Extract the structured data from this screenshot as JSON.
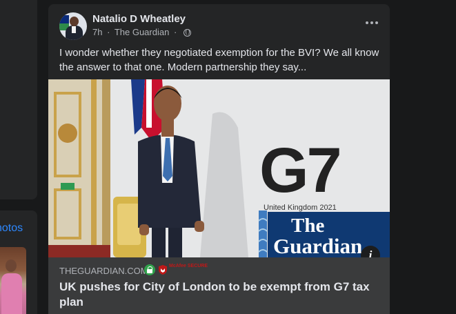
{
  "left_panel": {
    "photos_label": "notos"
  },
  "post": {
    "author": "Natalio D Wheatley",
    "time": "7h",
    "separator": "·",
    "source": "The Guardian",
    "separator2": "·",
    "text": "I wonder whether they negotiated exemption for the BVI? We all know the answer to that one. Modern partnership they say...",
    "link": {
      "image": {
        "g7_text": "G7",
        "uk_text": "United Kingdom 2021",
        "logo_line1": "The",
        "logo_line2": "Guardian"
      },
      "domain": "THEGUARDIAN.COM",
      "security_badge_text": "McAfee SECURE",
      "title": "UK pushes for City of London to be exempt from G7 tax plan"
    }
  },
  "icons": {
    "more": "more-options-icon",
    "globe": "globe-icon",
    "info": "info-icon",
    "lock": "lock-icon"
  },
  "colors": {
    "page_bg": "#18191a",
    "card_bg": "#242526",
    "link_meta_bg": "#3a3b3c",
    "text_primary": "#e4e6eb",
    "text_secondary": "#b0b3b8",
    "link_blue": "#2d88ff",
    "guardian_blue": "#0f3972"
  }
}
